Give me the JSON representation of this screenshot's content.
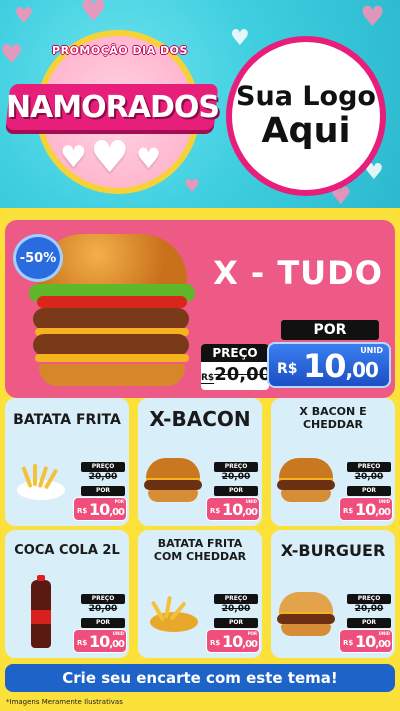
{
  "header": {
    "promo_arc": "PROMOÇÃO DIA DOS",
    "promo_title": "NAMORADOS",
    "logo_line1": "Sua Logo",
    "logo_line2": "Aqui"
  },
  "hero": {
    "discount": "-50%",
    "title": "X - TUDO",
    "preco_label": "PREÇO",
    "old_currency": "R$",
    "old_price": "20,00",
    "por_label": "POR",
    "currency": "R$",
    "price_main": "10",
    "price_cents": ",00",
    "unit": "UNID"
  },
  "products": [
    {
      "title": "BATATA FRITA",
      "preco_label": "PREÇO",
      "old_price": "20,00",
      "por_label": "POR",
      "currency": "R$",
      "price_main": "10",
      "price_cents": ",00",
      "unit": "POR"
    },
    {
      "title": "X-BACON",
      "preco_label": "PREÇO",
      "old_price": "20,00",
      "por_label": "POR",
      "currency": "R$",
      "price_main": "10",
      "price_cents": ",00",
      "unit": "UNID"
    },
    {
      "title": "X BACON E CHEDDAR",
      "preco_label": "PREÇO",
      "old_price": "20,00",
      "por_label": "POR",
      "currency": "R$",
      "price_main": "10",
      "price_cents": ",00",
      "unit": "UNID"
    },
    {
      "title": "COCA COLA 2L",
      "preco_label": "PREÇO",
      "old_price": "20,00",
      "por_label": "POR",
      "currency": "R$",
      "price_main": "10",
      "price_cents": ",00",
      "unit": "UNID"
    },
    {
      "title": "BATATA FRITA COM CHEDDAR",
      "preco_label": "PREÇO",
      "old_price": "20,00",
      "por_label": "POR",
      "currency": "R$",
      "price_main": "10",
      "price_cents": ",00",
      "unit": "POR"
    },
    {
      "title": "X-BURGUER",
      "preco_label": "PREÇO",
      "old_price": "20,00",
      "por_label": "POR",
      "currency": "R$",
      "price_main": "10",
      "price_cents": ",00",
      "unit": "UNID"
    }
  ],
  "footer": {
    "cta": "Crie seu encarte com este tema!",
    "disclaimer": "*Imagens Meramente Ilustrativas"
  },
  "colors": {
    "background_yellow": "#fbe13a",
    "header_cyan": "#3fcfe0",
    "hero_pink": "#ee5a86",
    "price_blue": "#1e63c8",
    "card_light_blue": "#d8eef8"
  }
}
